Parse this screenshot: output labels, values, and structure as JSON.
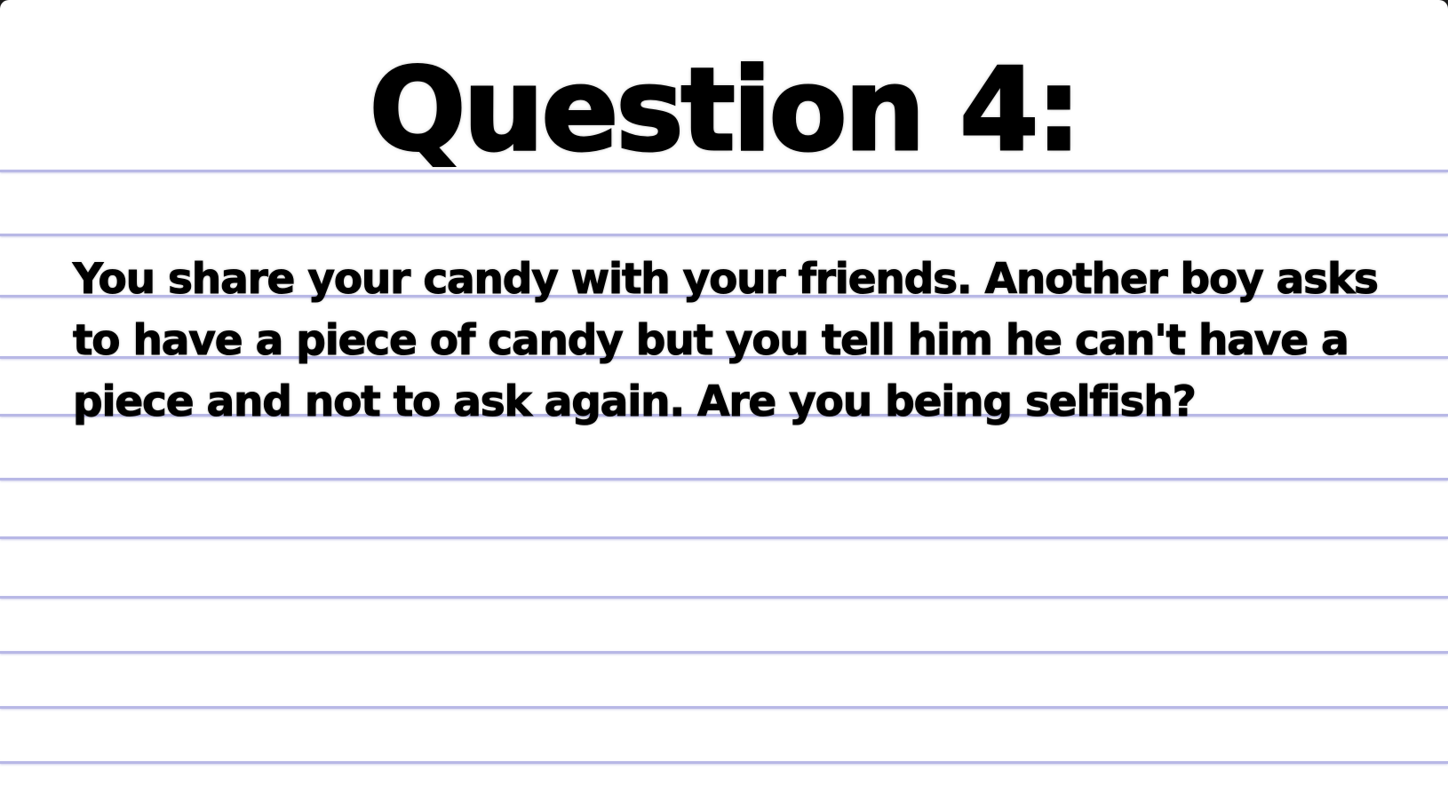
{
  "card": {
    "title": "Question 4:",
    "lines": [
      "You share your candy with your friends. Another boy asks",
      "to have a piece of candy but you tell him he can't have a",
      "piece and not to ask again.  Are you being selfish?"
    ]
  },
  "colors": {
    "background": "#ffffff",
    "rule_lines": "#b8b8e6",
    "text": "#000000"
  }
}
